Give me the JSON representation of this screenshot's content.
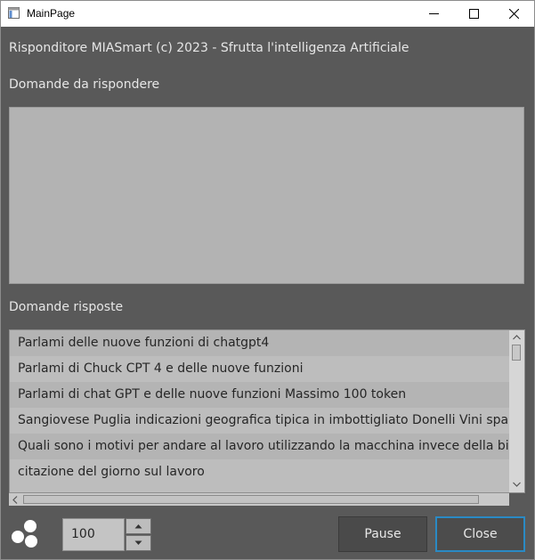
{
  "window": {
    "title": "MainPage",
    "icon": "app-window-icon",
    "controls": [
      "minimize-icon",
      "maximize-icon",
      "close-icon"
    ]
  },
  "header": {
    "text": "Risponditore MIASmart (c) 2023 - Sfrutta l'intelligenza Artificiale"
  },
  "pending": {
    "label": "Domande da rispondere",
    "items": []
  },
  "answered": {
    "label": "Domande risposte",
    "items": [
      "Parlami delle nuove funzioni di chatgpt4",
      "Parlami di Chuck CPT 4 e delle nuove funzioni",
      "Parlami di chat GPT e delle nuove funzioni Massimo 100 token",
      "Sangiovese Puglia indicazioni geografica tipica in imbottigliato Donelli Vini spa",
      "Quali sono i motivi per andare al lavoro utilizzando la macchina invece della bicicletta",
      "citazione del giorno sul lavoro"
    ]
  },
  "footer": {
    "spinner_value": "100",
    "pause_label": "Pause",
    "close_label": "Close",
    "status_icon": "loading-dots-icon"
  },
  "colors": {
    "background": "#595959",
    "accent": "#2a8ac4"
  }
}
